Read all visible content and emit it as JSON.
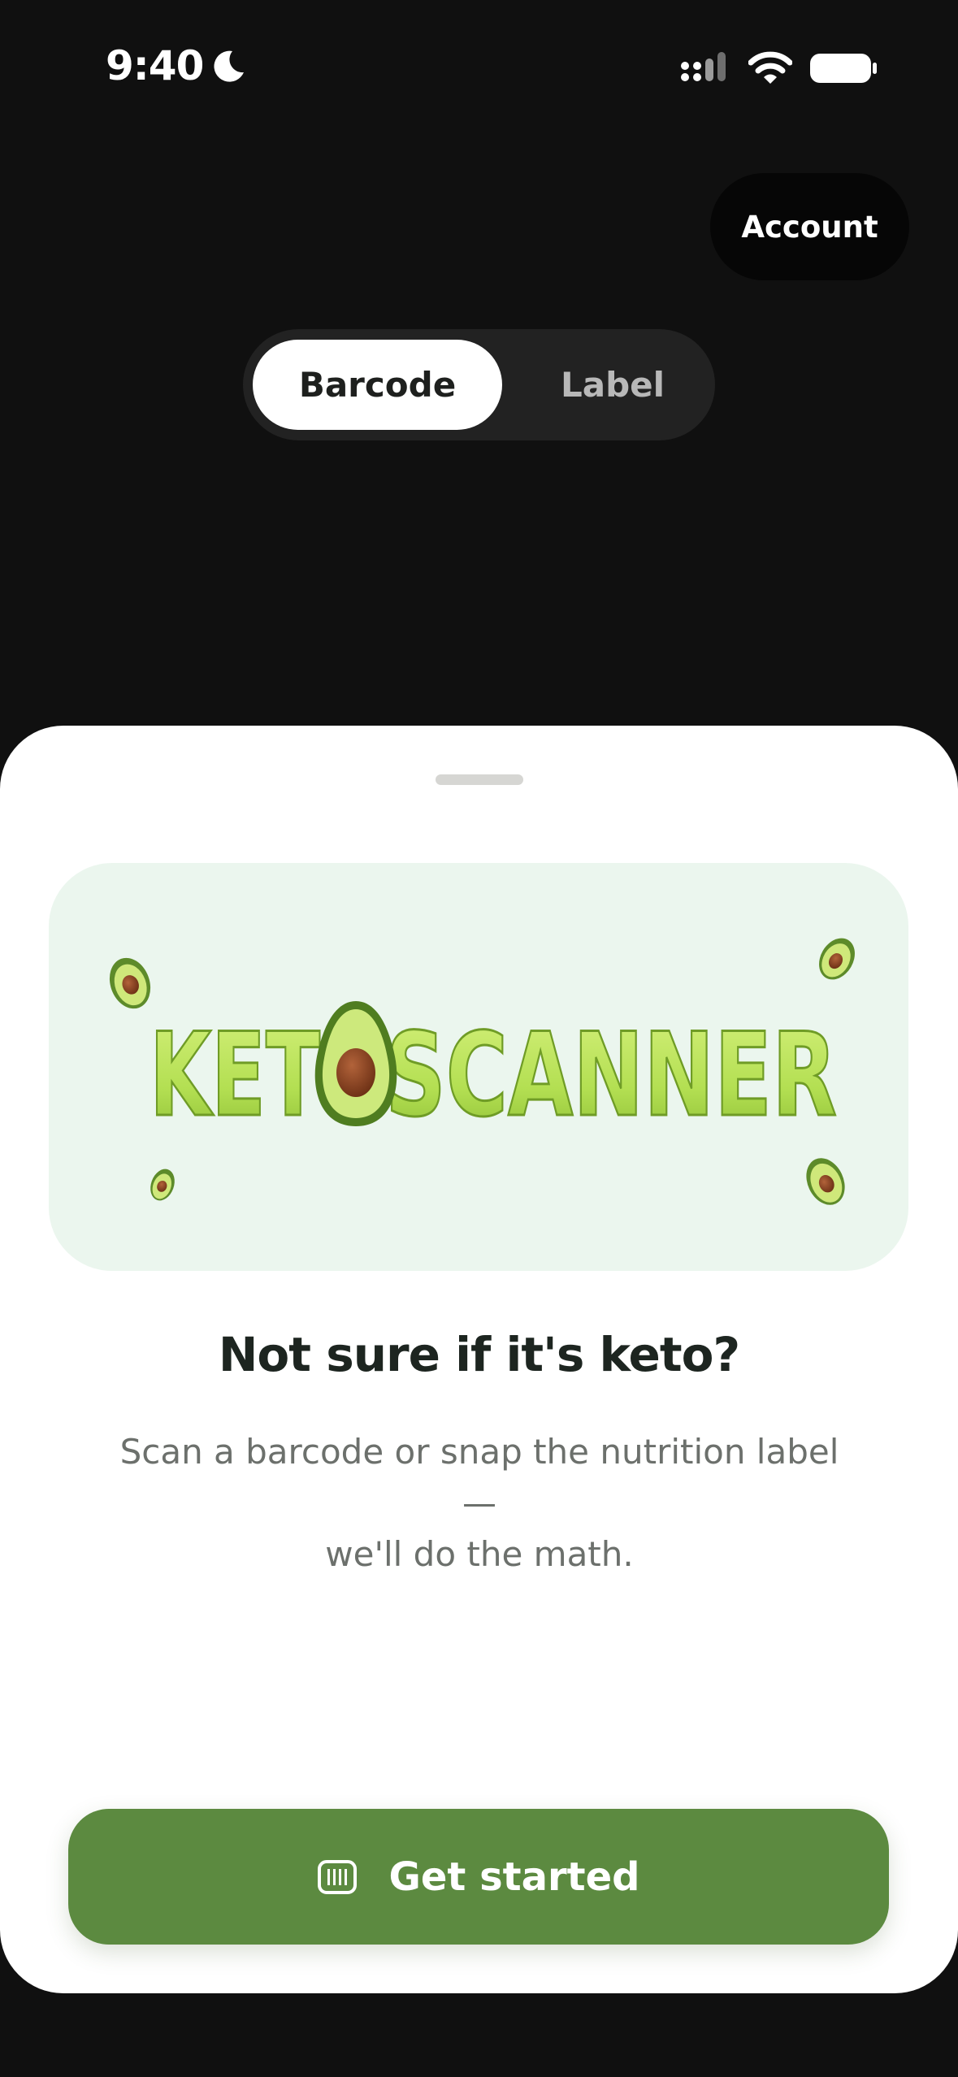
{
  "status_bar": {
    "time": "9:40",
    "icons": [
      "moon-icon",
      "signal-icon",
      "wifi-icon",
      "battery-icon"
    ]
  },
  "header": {
    "account_label": "Account"
  },
  "mode_switch": {
    "options": [
      "Barcode",
      "Label"
    ],
    "selected": "Barcode"
  },
  "sheet": {
    "logo_text": "KETOSCANNER",
    "headline": "Not sure if it's keto?",
    "subtext_line1": "Scan a barcode or snap the nutrition label —",
    "subtext_line2": "we'll do the math.",
    "cta_label": "Get started",
    "cta_icon": "barcode-icon"
  },
  "colors": {
    "background": "#101010",
    "sheet": "#ffffff",
    "hero_bg": "#ebf6ee",
    "accent": "#5c8a40",
    "logo_green": "#b8e35a"
  }
}
